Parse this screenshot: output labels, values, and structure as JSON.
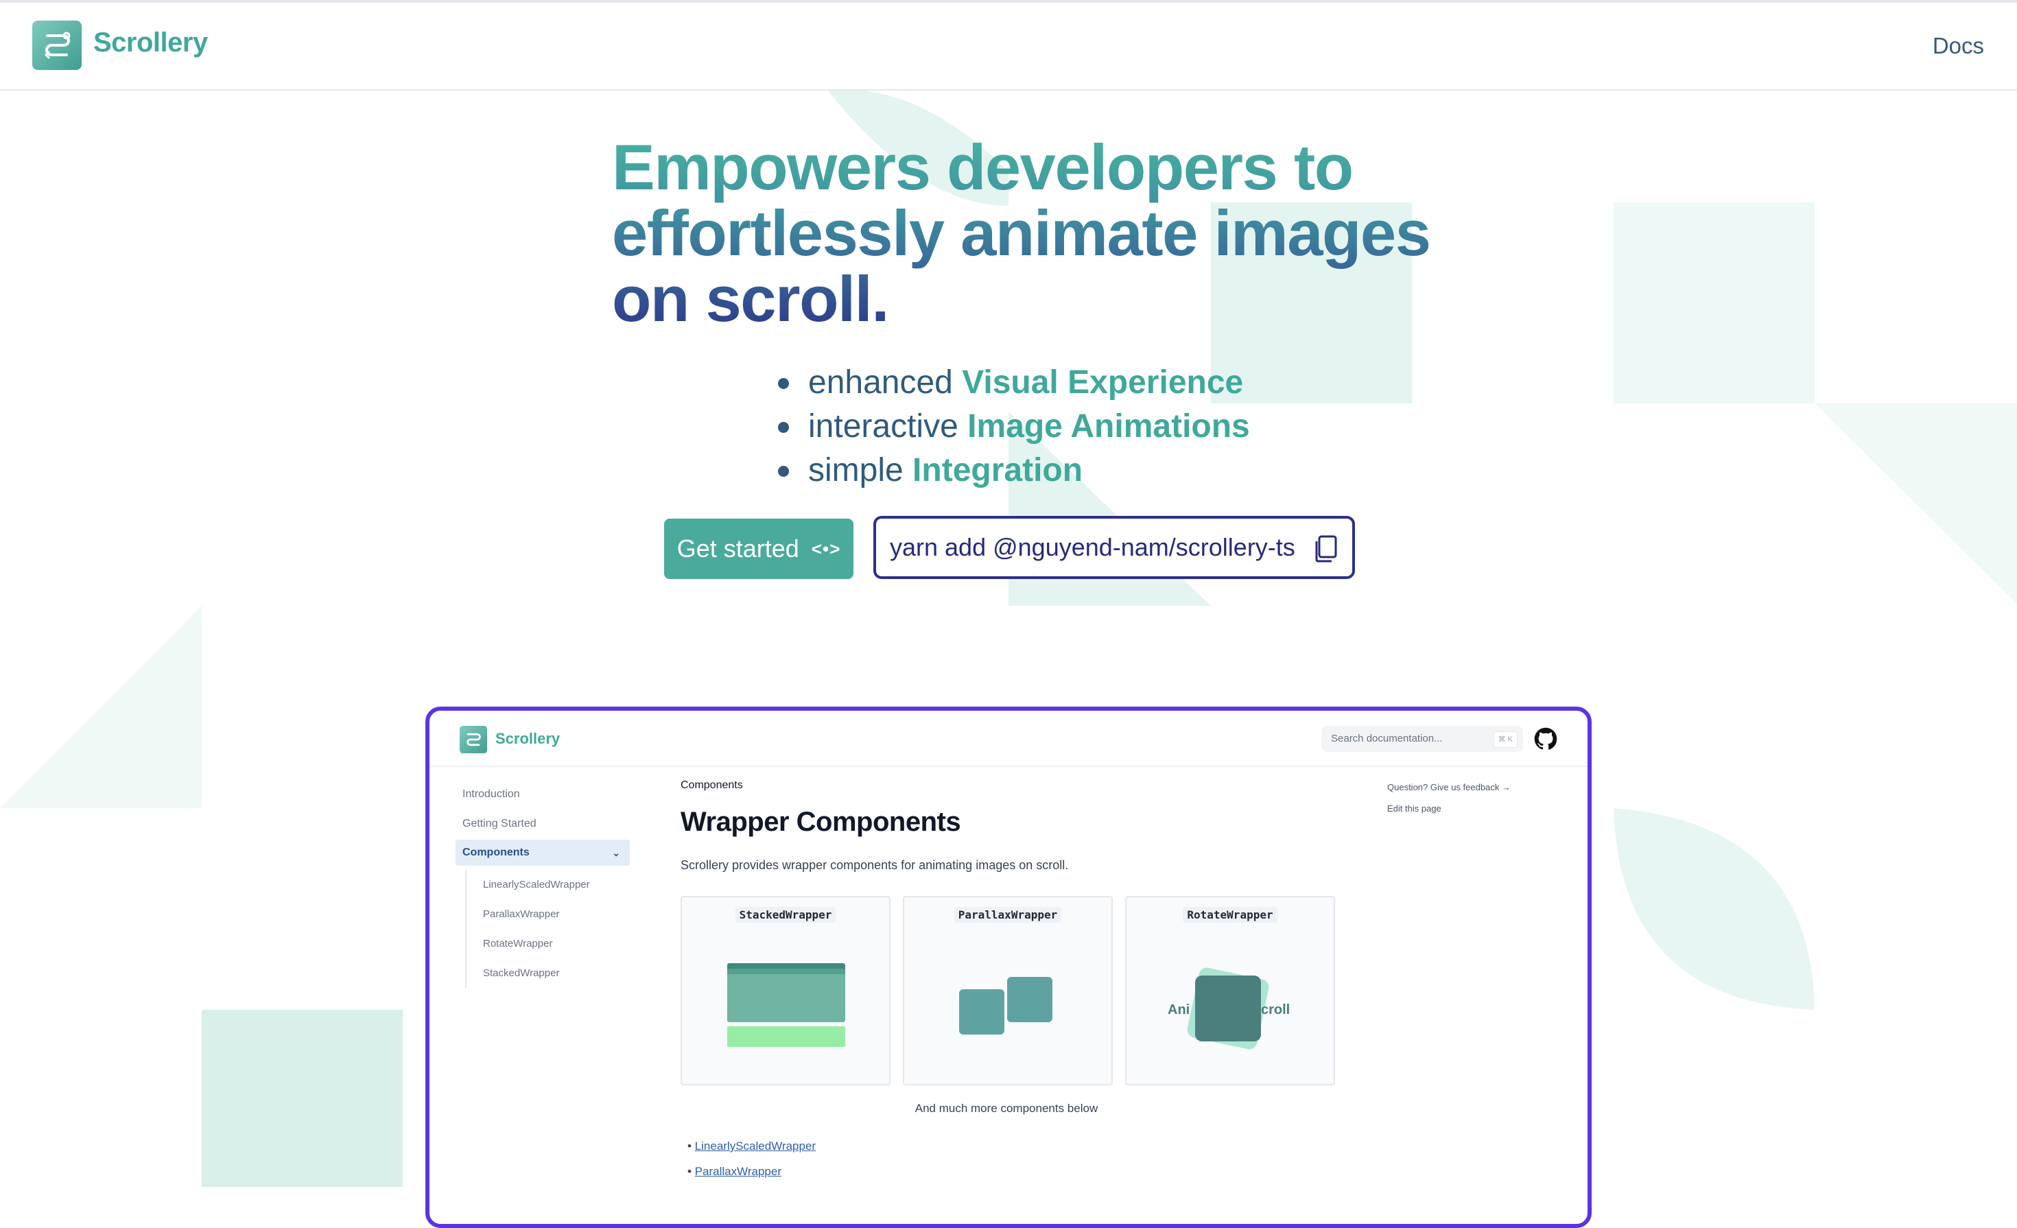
{
  "nav": {
    "brand": "Scrollery",
    "docs_label": "Docs"
  },
  "hero": {
    "title": "Empowers developers to effortlessly animate images on scroll.",
    "features": [
      {
        "plain": "enhanced ",
        "highlight": "Visual Experience"
      },
      {
        "plain": "interactive ",
        "highlight": "Image Animations"
      },
      {
        "plain": "simple ",
        "highlight": "Integration"
      }
    ],
    "get_started_label": "Get started",
    "get_started_icon": "<•>",
    "install_command": "yarn add @nguyend-nam/scrollery-ts"
  },
  "preview": {
    "brand": "Scrollery",
    "search_placeholder": "Search documentation...",
    "search_shortcut": "⌘ K",
    "nav": {
      "items": [
        "Introduction",
        "Getting Started"
      ],
      "active": "Components",
      "sub_items": [
        "LinearlyScaledWrapper",
        "ParallaxWrapper",
        "RotateWrapper",
        "StackedWrapper"
      ]
    },
    "breadcrumb": "Components",
    "heading": "Wrapper Components",
    "description": "Scrollery provides wrapper components for animating images on scroll.",
    "cards": [
      "StackedWrapper",
      "ParallaxWrapper",
      "RotateWrapper"
    ],
    "rotate_demo_text": {
      "left": "Ani",
      "right": "croll"
    },
    "more_text": "And much more components below",
    "links": [
      "LinearlyScaledWrapper",
      "ParallaxWrapper"
    ],
    "aside": {
      "feedback": "Question? Give us feedback →",
      "edit": "Edit this page"
    }
  },
  "colors": {
    "brand_teal": "#3fa89b",
    "button": "#4aaa9c",
    "install_border": "#2d2e8f",
    "preview_border": "#5b34e0",
    "deco_shape": "#e4f4f1"
  }
}
